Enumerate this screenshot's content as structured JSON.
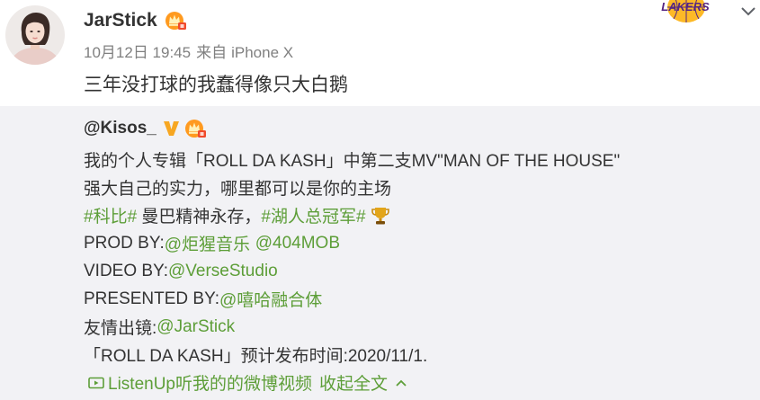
{
  "colors": {
    "text": "#333333",
    "meta": "#808080",
    "link": "#5d9e38",
    "repost_bg": "#f2f2f5",
    "badge_orange": "#ff9a1f",
    "verified_gold": "#f7a722",
    "lakers_purple": "#552583",
    "lakers_gold": "#fdb927"
  },
  "post": {
    "avatar_icon": "avatar-photo",
    "author": {
      "name": "JarStick",
      "badge_icon": "vip-crown-icon"
    },
    "card_logo": {
      "icon": "lakers-logo",
      "text": "LAKERS"
    },
    "menu_icon": "chevron-down-icon",
    "meta": {
      "time": "10月12日 19:45",
      "source_prefix": "来自",
      "source": "iPhone X"
    },
    "text": "三年没打球的我蠢得像只大白鹅"
  },
  "repost": {
    "author": "@Kisos_",
    "author_badges": [
      "verified-v-icon",
      "vip-crown-icon"
    ],
    "lines": [
      {
        "segments": [
          {
            "text": "我的个人专辑「ROLL DA KASH」中第二支MV\"MAN OF THE HOUSE\"",
            "link": false
          }
        ]
      },
      {
        "segments": [
          {
            "text": "强大自己的实力，哪里都可以是你的主场",
            "link": false
          }
        ]
      },
      {
        "segments": [
          {
            "text": "#科比#",
            "link": true
          },
          {
            "text": " 曼巴精神永存，",
            "link": false
          },
          {
            "text": "#湖人总冠军#",
            "link": true
          },
          {
            "icon": "trophy-icon"
          }
        ]
      },
      {
        "segments": [
          {
            "text": "PROD BY:",
            "link": false
          },
          {
            "text": "@炬猩音乐",
            "link": true
          },
          {
            "text": "@404MOB",
            "link": true
          }
        ]
      },
      {
        "segments": [
          {
            "text": "VIDEO BY:",
            "link": false
          },
          {
            "text": "@VerseStudio",
            "link": true
          }
        ]
      },
      {
        "segments": [
          {
            "text": "PRESENTED BY:",
            "link": false
          },
          {
            "text": "@嘻哈融合体",
            "link": true
          }
        ]
      },
      {
        "segments": [
          {
            "text": "友情出镜:",
            "link": false
          },
          {
            "text": "@JarStick",
            "link": true
          }
        ]
      },
      {
        "segments": [
          {
            "text": "「ROLL DA KASH」预计发布时间:2020/11/1.",
            "link": false
          }
        ]
      }
    ],
    "video_link": {
      "icon": "video-icon",
      "label": "ListenUp听我的的微博视频"
    },
    "collapse": {
      "label": "收起全文",
      "icon": "chevron-up-icon"
    }
  }
}
